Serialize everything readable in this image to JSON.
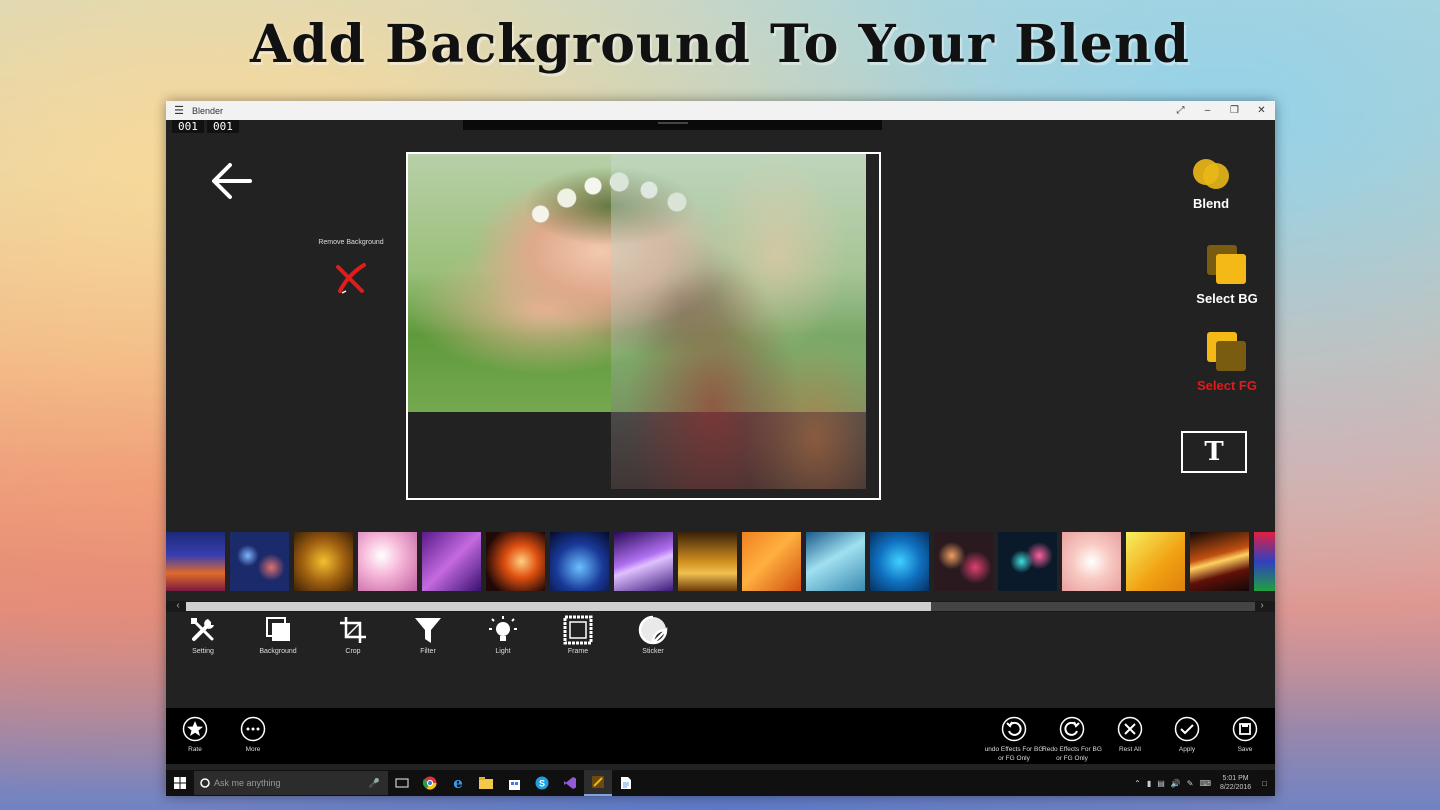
{
  "headline": "Add Background To Your Blend",
  "window": {
    "title": "Blender",
    "counter_left": "001",
    "counter_right": "001"
  },
  "editor": {
    "remove_background_label": "Remove Background"
  },
  "side_panel": {
    "blend": "Blend",
    "select_bg": "Select BG",
    "select_fg": "Select FG",
    "text_tool": "T"
  },
  "tools": [
    "Setting",
    "Background",
    "Crop",
    "Filter",
    "Light",
    "Frame",
    "Sticker"
  ],
  "actions": {
    "rate": "Rate",
    "more": "More",
    "undo": "undo Effects For BG or FG Only",
    "redo": "Redo Effects For BG or FG Only",
    "reset": "Rest All",
    "apply": "Apply",
    "save": "Save"
  },
  "taskbar": {
    "search_placeholder": "Ask me anything",
    "time": "5:01 PM",
    "date": "8/22/2016"
  },
  "colors": {
    "accent_gold": "#e8b818",
    "accent_red": "#e21b1b",
    "app_bg": "#222222"
  }
}
